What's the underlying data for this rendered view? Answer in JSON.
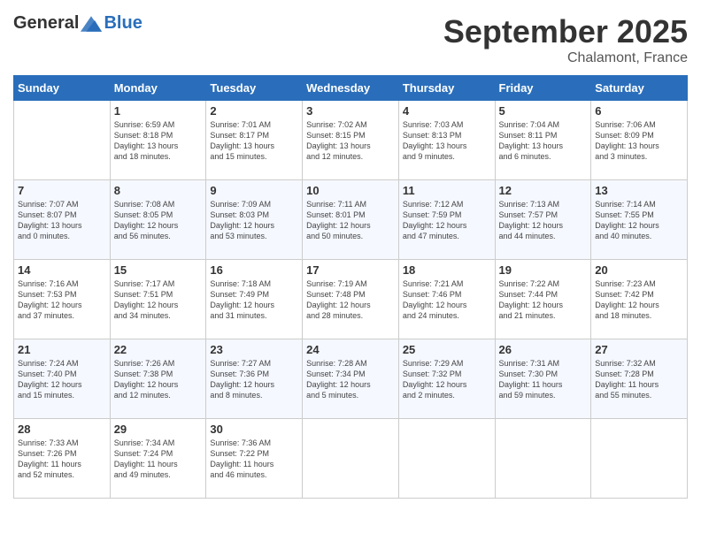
{
  "header": {
    "logo_general": "General",
    "logo_blue": "Blue",
    "month": "September 2025",
    "location": "Chalamont, France"
  },
  "days_of_week": [
    "Sunday",
    "Monday",
    "Tuesday",
    "Wednesday",
    "Thursday",
    "Friday",
    "Saturday"
  ],
  "weeks": [
    {
      "days": [
        {
          "num": "",
          "data": ""
        },
        {
          "num": "1",
          "data": "Sunrise: 6:59 AM\nSunset: 8:18 PM\nDaylight: 13 hours\nand 18 minutes."
        },
        {
          "num": "2",
          "data": "Sunrise: 7:01 AM\nSunset: 8:17 PM\nDaylight: 13 hours\nand 15 minutes."
        },
        {
          "num": "3",
          "data": "Sunrise: 7:02 AM\nSunset: 8:15 PM\nDaylight: 13 hours\nand 12 minutes."
        },
        {
          "num": "4",
          "data": "Sunrise: 7:03 AM\nSunset: 8:13 PM\nDaylight: 13 hours\nand 9 minutes."
        },
        {
          "num": "5",
          "data": "Sunrise: 7:04 AM\nSunset: 8:11 PM\nDaylight: 13 hours\nand 6 minutes."
        },
        {
          "num": "6",
          "data": "Sunrise: 7:06 AM\nSunset: 8:09 PM\nDaylight: 13 hours\nand 3 minutes."
        }
      ]
    },
    {
      "days": [
        {
          "num": "7",
          "data": "Sunrise: 7:07 AM\nSunset: 8:07 PM\nDaylight: 13 hours\nand 0 minutes."
        },
        {
          "num": "8",
          "data": "Sunrise: 7:08 AM\nSunset: 8:05 PM\nDaylight: 12 hours\nand 56 minutes."
        },
        {
          "num": "9",
          "data": "Sunrise: 7:09 AM\nSunset: 8:03 PM\nDaylight: 12 hours\nand 53 minutes."
        },
        {
          "num": "10",
          "data": "Sunrise: 7:11 AM\nSunset: 8:01 PM\nDaylight: 12 hours\nand 50 minutes."
        },
        {
          "num": "11",
          "data": "Sunrise: 7:12 AM\nSunset: 7:59 PM\nDaylight: 12 hours\nand 47 minutes."
        },
        {
          "num": "12",
          "data": "Sunrise: 7:13 AM\nSunset: 7:57 PM\nDaylight: 12 hours\nand 44 minutes."
        },
        {
          "num": "13",
          "data": "Sunrise: 7:14 AM\nSunset: 7:55 PM\nDaylight: 12 hours\nand 40 minutes."
        }
      ]
    },
    {
      "days": [
        {
          "num": "14",
          "data": "Sunrise: 7:16 AM\nSunset: 7:53 PM\nDaylight: 12 hours\nand 37 minutes."
        },
        {
          "num": "15",
          "data": "Sunrise: 7:17 AM\nSunset: 7:51 PM\nDaylight: 12 hours\nand 34 minutes."
        },
        {
          "num": "16",
          "data": "Sunrise: 7:18 AM\nSunset: 7:49 PM\nDaylight: 12 hours\nand 31 minutes."
        },
        {
          "num": "17",
          "data": "Sunrise: 7:19 AM\nSunset: 7:48 PM\nDaylight: 12 hours\nand 28 minutes."
        },
        {
          "num": "18",
          "data": "Sunrise: 7:21 AM\nSunset: 7:46 PM\nDaylight: 12 hours\nand 24 minutes."
        },
        {
          "num": "19",
          "data": "Sunrise: 7:22 AM\nSunset: 7:44 PM\nDaylight: 12 hours\nand 21 minutes."
        },
        {
          "num": "20",
          "data": "Sunrise: 7:23 AM\nSunset: 7:42 PM\nDaylight: 12 hours\nand 18 minutes."
        }
      ]
    },
    {
      "days": [
        {
          "num": "21",
          "data": "Sunrise: 7:24 AM\nSunset: 7:40 PM\nDaylight: 12 hours\nand 15 minutes."
        },
        {
          "num": "22",
          "data": "Sunrise: 7:26 AM\nSunset: 7:38 PM\nDaylight: 12 hours\nand 12 minutes."
        },
        {
          "num": "23",
          "data": "Sunrise: 7:27 AM\nSunset: 7:36 PM\nDaylight: 12 hours\nand 8 minutes."
        },
        {
          "num": "24",
          "data": "Sunrise: 7:28 AM\nSunset: 7:34 PM\nDaylight: 12 hours\nand 5 minutes."
        },
        {
          "num": "25",
          "data": "Sunrise: 7:29 AM\nSunset: 7:32 PM\nDaylight: 12 hours\nand 2 minutes."
        },
        {
          "num": "26",
          "data": "Sunrise: 7:31 AM\nSunset: 7:30 PM\nDaylight: 11 hours\nand 59 minutes."
        },
        {
          "num": "27",
          "data": "Sunrise: 7:32 AM\nSunset: 7:28 PM\nDaylight: 11 hours\nand 55 minutes."
        }
      ]
    },
    {
      "days": [
        {
          "num": "28",
          "data": "Sunrise: 7:33 AM\nSunset: 7:26 PM\nDaylight: 11 hours\nand 52 minutes."
        },
        {
          "num": "29",
          "data": "Sunrise: 7:34 AM\nSunset: 7:24 PM\nDaylight: 11 hours\nand 49 minutes."
        },
        {
          "num": "30",
          "data": "Sunrise: 7:36 AM\nSunset: 7:22 PM\nDaylight: 11 hours\nand 46 minutes."
        },
        {
          "num": "",
          "data": ""
        },
        {
          "num": "",
          "data": ""
        },
        {
          "num": "",
          "data": ""
        },
        {
          "num": "",
          "data": ""
        }
      ]
    }
  ]
}
